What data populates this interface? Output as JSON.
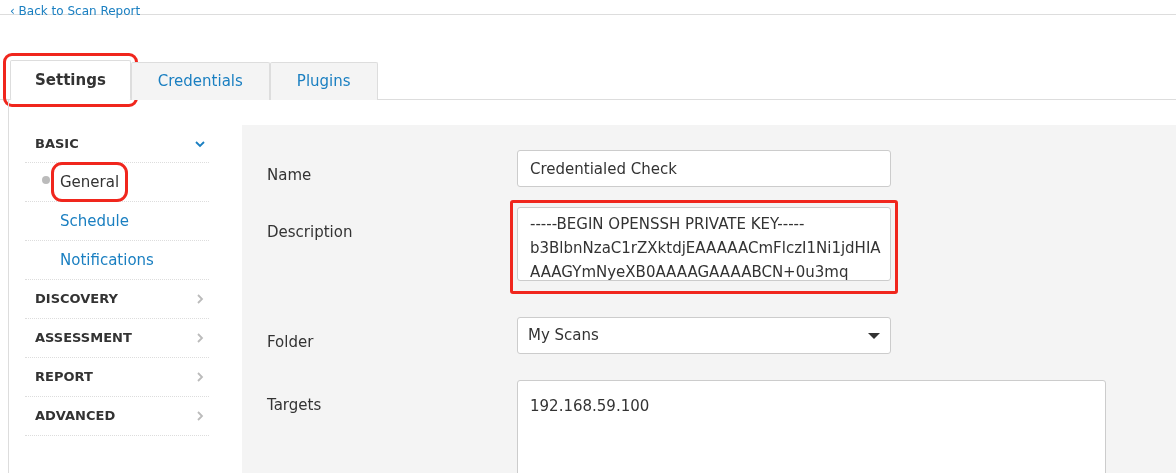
{
  "back_link": "‹ Back to Scan Report",
  "tabs": [
    {
      "label": "Settings",
      "selected": true,
      "highlighted": true
    },
    {
      "label": "Credentials",
      "selected": false,
      "highlighted": false
    },
    {
      "label": "Plugins",
      "selected": false,
      "highlighted": false
    }
  ],
  "sidebar": {
    "sections": [
      {
        "label": "BASIC",
        "expanded": true,
        "items": [
          {
            "label": "General",
            "selected": true,
            "highlighted": true
          },
          {
            "label": "Schedule",
            "selected": false,
            "highlighted": false
          },
          {
            "label": "Notifications",
            "selected": false,
            "highlighted": false
          }
        ]
      },
      {
        "label": "DISCOVERY",
        "expanded": false
      },
      {
        "label": "ASSESSMENT",
        "expanded": false
      },
      {
        "label": "REPORT",
        "expanded": false
      },
      {
        "label": "ADVANCED",
        "expanded": false
      }
    ]
  },
  "form": [
    {
      "kind": "text",
      "label": "Name",
      "value": "Credentialed Check"
    },
    {
      "kind": "textarea",
      "label": "Description",
      "value": "-----BEGIN OPENSSH PRIVATE KEY-----\nb3BlbnNzaC1rZXktdjEAAAAACmFlczI1Ni1jdHIA\nAAAGYmNyeXB0AAAAGAAAABCN+0u3mq",
      "highlighted": true
    },
    {
      "kind": "select",
      "label": "Folder",
      "value": "My Scans"
    },
    {
      "kind": "targets",
      "label": "Targets",
      "value": "192.168.59.100"
    }
  ]
}
